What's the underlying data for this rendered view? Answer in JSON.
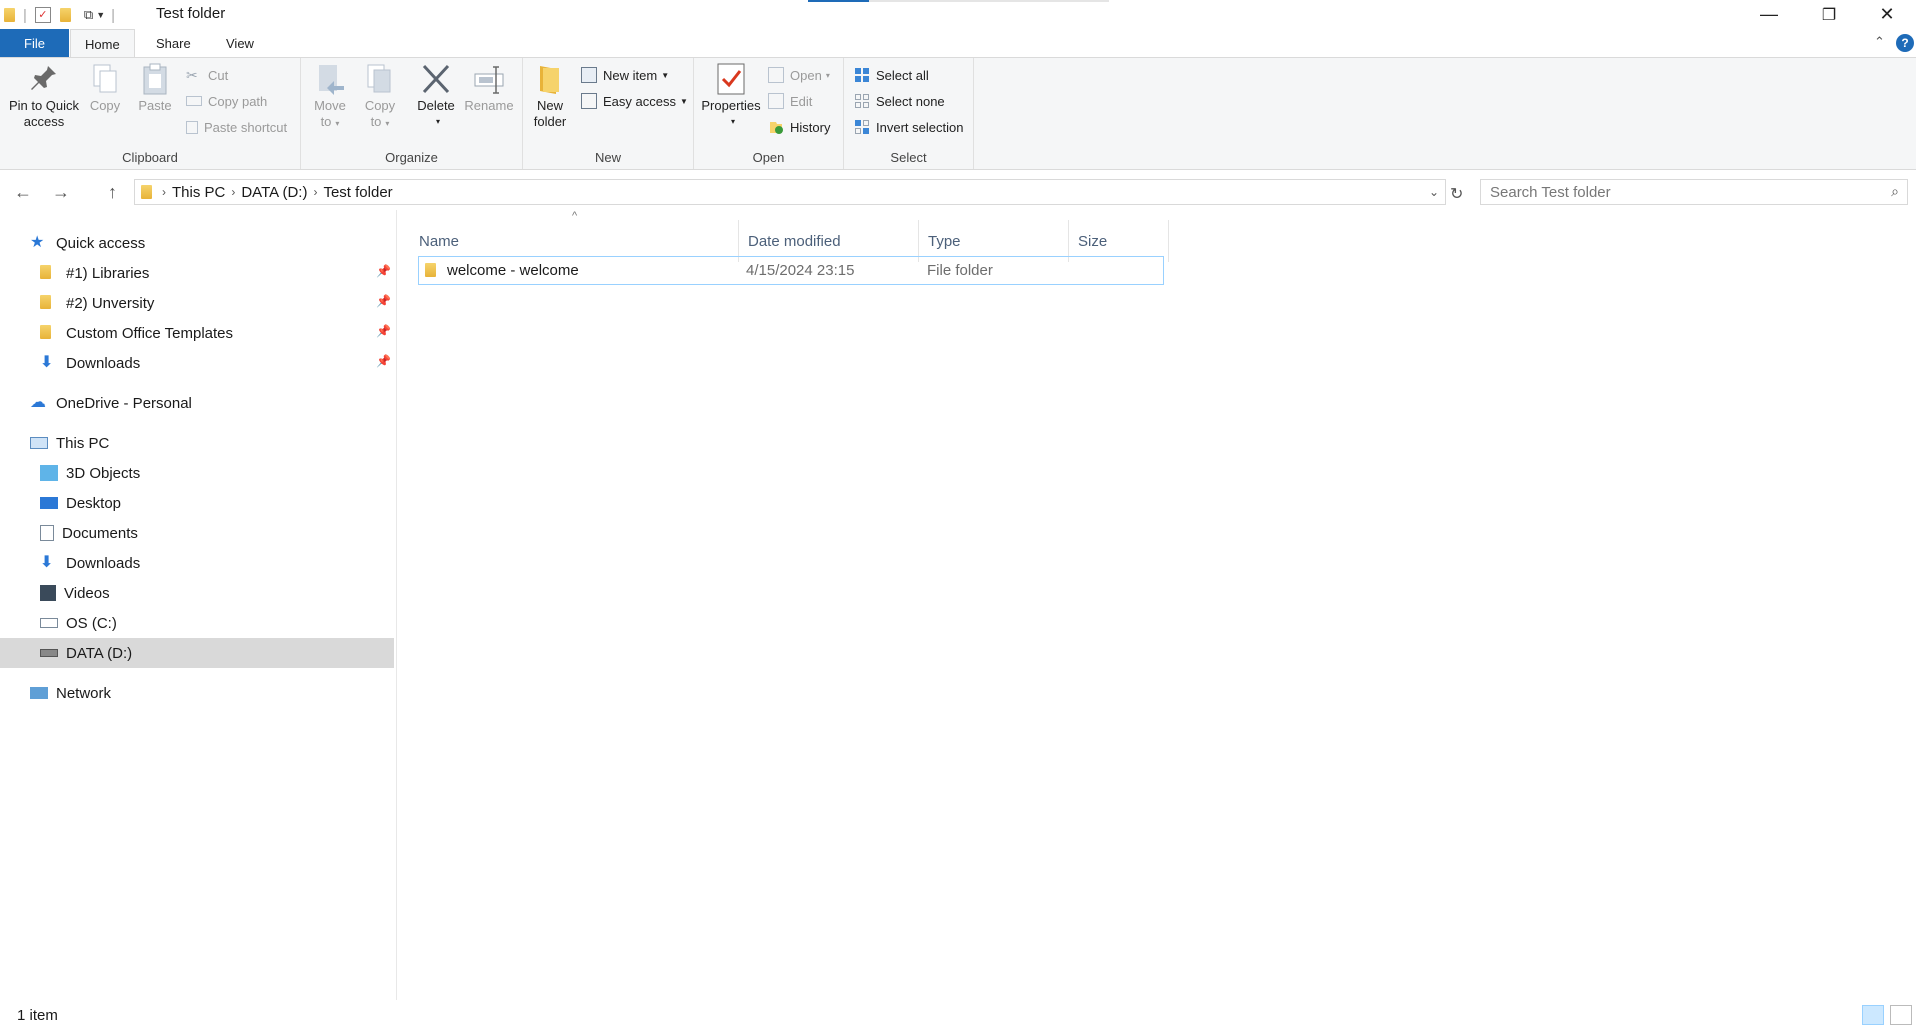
{
  "window": {
    "title": "Test folder",
    "minimize_glyph": "—",
    "restore_glyph": "❐",
    "close_glyph": "✕"
  },
  "ribbon_tabs": {
    "file": "File",
    "home": "Home",
    "share": "Share",
    "view": "View"
  },
  "clipboard": {
    "pin": "Pin to Quick access",
    "pin_line1": "Pin to Quick",
    "pin_line2": "access",
    "copy": "Copy",
    "paste": "Paste",
    "cut": "Cut",
    "copy_path": "Copy path",
    "paste_shortcut": "Paste shortcut",
    "label": "Clipboard"
  },
  "organize": {
    "move_line1": "Move",
    "move_line2": "to",
    "copy_line1": "Copy",
    "copy_line2": "to",
    "delete": "Delete",
    "rename": "Rename",
    "label": "Organize"
  },
  "new_group": {
    "new_folder_line1": "New",
    "new_folder_line2": "folder",
    "new_item": "New item",
    "easy_access": "Easy access",
    "label": "New"
  },
  "open_group": {
    "properties": "Properties",
    "open": "Open",
    "edit": "Edit",
    "history": "History",
    "label": "Open"
  },
  "select_group": {
    "select_all": "Select all",
    "select_none": "Select none",
    "invert_selection": "Invert selection",
    "label": "Select"
  },
  "address": {
    "crumbs": [
      "This PC",
      "DATA (D:)",
      "Test folder"
    ],
    "search_placeholder": "Search Test folder"
  },
  "nav": {
    "quick_access": "Quick access",
    "quick_items": [
      "#1) Libraries",
      "#2) Unversity",
      "Custom Office Templates",
      "Downloads"
    ],
    "onedrive": "OneDrive - Personal",
    "this_pc": "This PC",
    "pc_items": [
      "3D Objects",
      "Desktop",
      "Documents",
      "Downloads",
      "Videos",
      "OS (C:)",
      "DATA (D:)"
    ],
    "network": "Network"
  },
  "columns": {
    "name": "Name",
    "date": "Date modified",
    "type": "Type",
    "size": "Size"
  },
  "files": [
    {
      "name": "welcome - welcome",
      "date": "4/15/2024 23:15",
      "type": "File folder",
      "size": ""
    }
  ],
  "status": {
    "count": "1 item"
  },
  "colors": {
    "accent": "#1e6bb8",
    "folder": "#e8b339",
    "selection_border": "#99d1ff",
    "nav_selected": "#d9d9d9"
  }
}
